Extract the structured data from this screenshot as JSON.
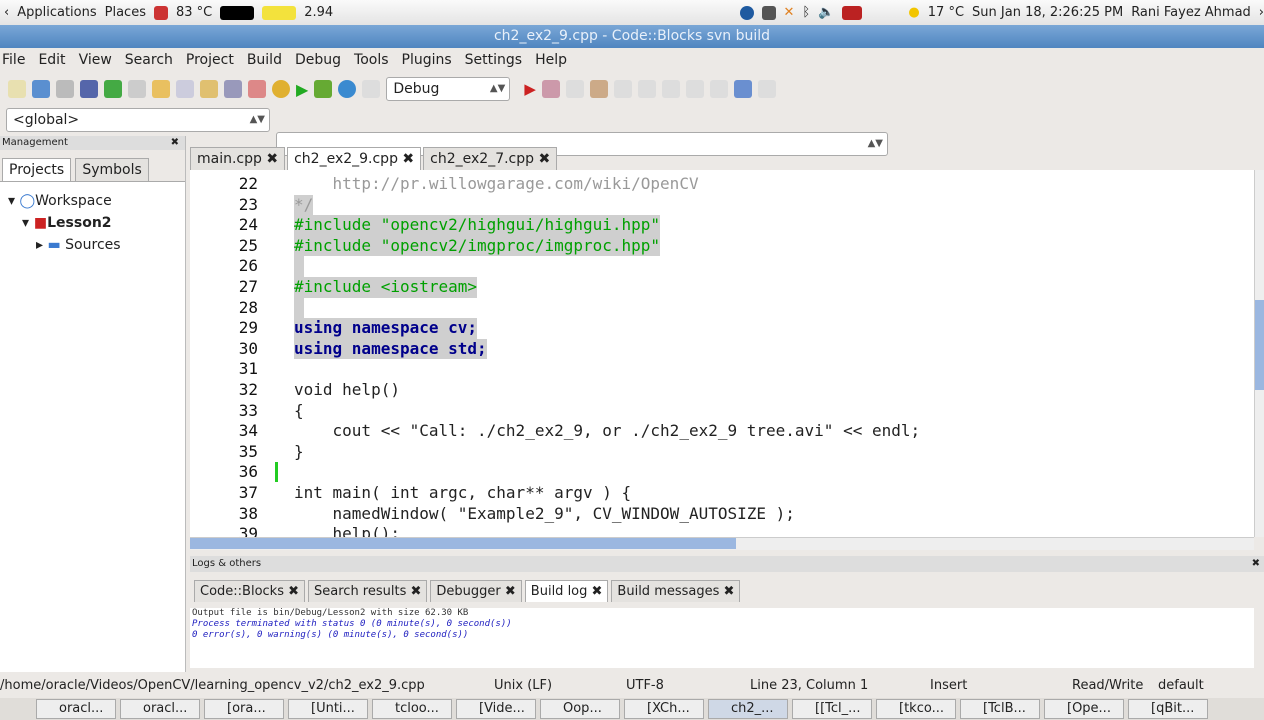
{
  "panel": {
    "applications": "Applications",
    "places": "Places",
    "cpu_temp": "83 °C",
    "load": "2.94",
    "weather": "17 °C",
    "datetime": "Sun Jan 18,  2:26:25 PM",
    "user": "Rani Fayez Ahmad"
  },
  "window": {
    "title": "ch2_ex2_9.cpp - Code::Blocks svn build"
  },
  "menu": [
    "File",
    "Edit",
    "View",
    "Search",
    "Project",
    "Build",
    "Debug",
    "Tools",
    "Plugins",
    "Settings",
    "Help"
  ],
  "toolbar": {
    "build_target": "Debug",
    "scope": "<global>"
  },
  "management": {
    "header": "Management",
    "tabs": [
      "Projects",
      "Symbols"
    ],
    "tree": [
      "Workspace",
      "Lesson2",
      "Sources"
    ]
  },
  "editor": {
    "tabs": [
      "main.cpp",
      "ch2_ex2_9.cpp",
      "ch2_ex2_7.cpp"
    ],
    "active_tab": 1,
    "lines": [
      {
        "n": "22",
        "t": "    http://pr.willowgarage.com/wiki/OpenCV",
        "c": "cm",
        "s": false
      },
      {
        "n": "23",
        "t": "*/",
        "c": "cm",
        "s": true
      },
      {
        "n": "24",
        "t": "#include \"opencv2/highgui/highgui.hpp\"",
        "c": "pp",
        "s": true
      },
      {
        "n": "25",
        "t": "#include \"opencv2/imgproc/imgproc.hpp\"",
        "c": "pp",
        "s": true
      },
      {
        "n": "26",
        "t": " ",
        "c": "",
        "s": true
      },
      {
        "n": "27",
        "t": "#include <iostream>",
        "c": "pp",
        "s": true
      },
      {
        "n": "28",
        "t": " ",
        "c": "",
        "s": true
      },
      {
        "n": "29",
        "t": "using namespace cv;",
        "c": "kw",
        "s": true
      },
      {
        "n": "30",
        "t": "using namespace std;",
        "c": "kw",
        "s": true
      },
      {
        "n": "31",
        "t": "",
        "c": "",
        "s": false
      },
      {
        "n": "32",
        "t": "void help()",
        "c": "",
        "s": false
      },
      {
        "n": "33",
        "t": "{",
        "c": "",
        "s": false
      },
      {
        "n": "34",
        "t": "    cout << \"Call: ./ch2_ex2_9, or ./ch2_ex2_9 tree.avi\" << endl;",
        "c": "",
        "s": false
      },
      {
        "n": "35",
        "t": "}",
        "c": "",
        "s": false
      },
      {
        "n": "36",
        "t": "",
        "c": "",
        "s": false
      },
      {
        "n": "37",
        "t": "int main( int argc, char** argv ) {",
        "c": "",
        "s": false
      },
      {
        "n": "38",
        "t": "    namedWindow( \"Example2_9\", CV_WINDOW_AUTOSIZE );",
        "c": "",
        "s": false
      },
      {
        "n": "39",
        "t": "    help();",
        "c": "",
        "s": false
      }
    ]
  },
  "logs": {
    "header": "Logs & others",
    "tabs": [
      "Code::Blocks",
      "Search results",
      "Debugger",
      "Build log",
      "Build messages"
    ],
    "active_tab": 3,
    "lines": [
      "Output file is bin/Debug/Lesson2 with size 62.30 KB",
      "Process terminated with status 0 (0 minute(s), 0 second(s))",
      "0 error(s), 0 warning(s) (0 minute(s), 0 second(s))"
    ]
  },
  "status": {
    "path": "/home/oracle/Videos/OpenCV/learning_opencv_v2/ch2_ex2_9.cpp",
    "eol": "Unix (LF)",
    "encoding": "UTF-8",
    "position": "Line 23, Column 1",
    "mode": "Insert",
    "access": "Read/Write",
    "lang": "default"
  },
  "taskbar": [
    "oracl...",
    "oracl...",
    "[ora...",
    "[Unti...",
    "tcloo...",
    "[Vide...",
    "Oop...",
    "[XCh...",
    "ch2_...",
    "[[Tcl_...",
    "[tkco...",
    "[TclB...",
    "[Ope...",
    "[qBit..."
  ]
}
